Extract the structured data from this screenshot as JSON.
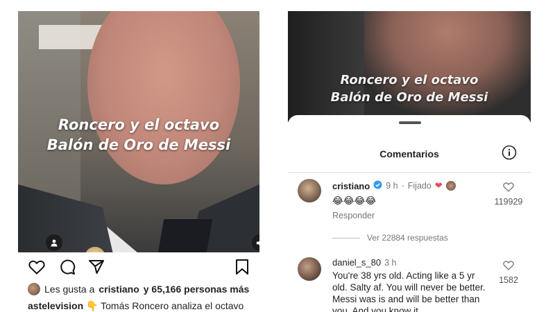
{
  "post": {
    "video_overlay_lines": [
      "Roncero y el octavo",
      "Balón de Oro de Messi"
    ],
    "icons": {
      "user_tag": "person-icon",
      "mute": "speaker-muted-icon",
      "like": "heart-outline-icon",
      "comment": "comment-bubble-icon",
      "share": "paper-plane-icon",
      "save": "bookmark-icon"
    },
    "likes_prefix": "Les gusta a",
    "likes_user": "cristiano",
    "likes_suffix": "y 65,166 personas más",
    "caption_user": "astelevision",
    "caption_emoji": "👇",
    "caption_text": "Tomás Roncero analiza el octavo"
  },
  "comments_sheet": {
    "video_overlay_lines": [
      "Roncero y el octavo",
      "Balón de Oro de Messi"
    ],
    "title": "Comentarios",
    "info_icon": "info-icon",
    "comments": [
      {
        "username": "cristiano",
        "verified": true,
        "time": "9 h",
        "pinned_label": "Fijado",
        "heart": "❤",
        "text": "😂😂😂😂",
        "reply_label": "Responder",
        "like_count": "119929",
        "view_replies": "Ver 22884 respuestas"
      },
      {
        "username": "daniel_s_80",
        "time": "3 h",
        "text_lines": [
          "You're 38 yrs old. Acting like a 5 yr",
          "old. Salty af. You will never be better.",
          "Messi was is and will be better than",
          "you. And you know it."
        ],
        "like_count": "1582"
      }
    ]
  },
  "colors": {
    "verified_blue": "#3897f0",
    "heart_red": "#ed4956",
    "text_primary": "#222222",
    "text_secondary": "#777777"
  }
}
